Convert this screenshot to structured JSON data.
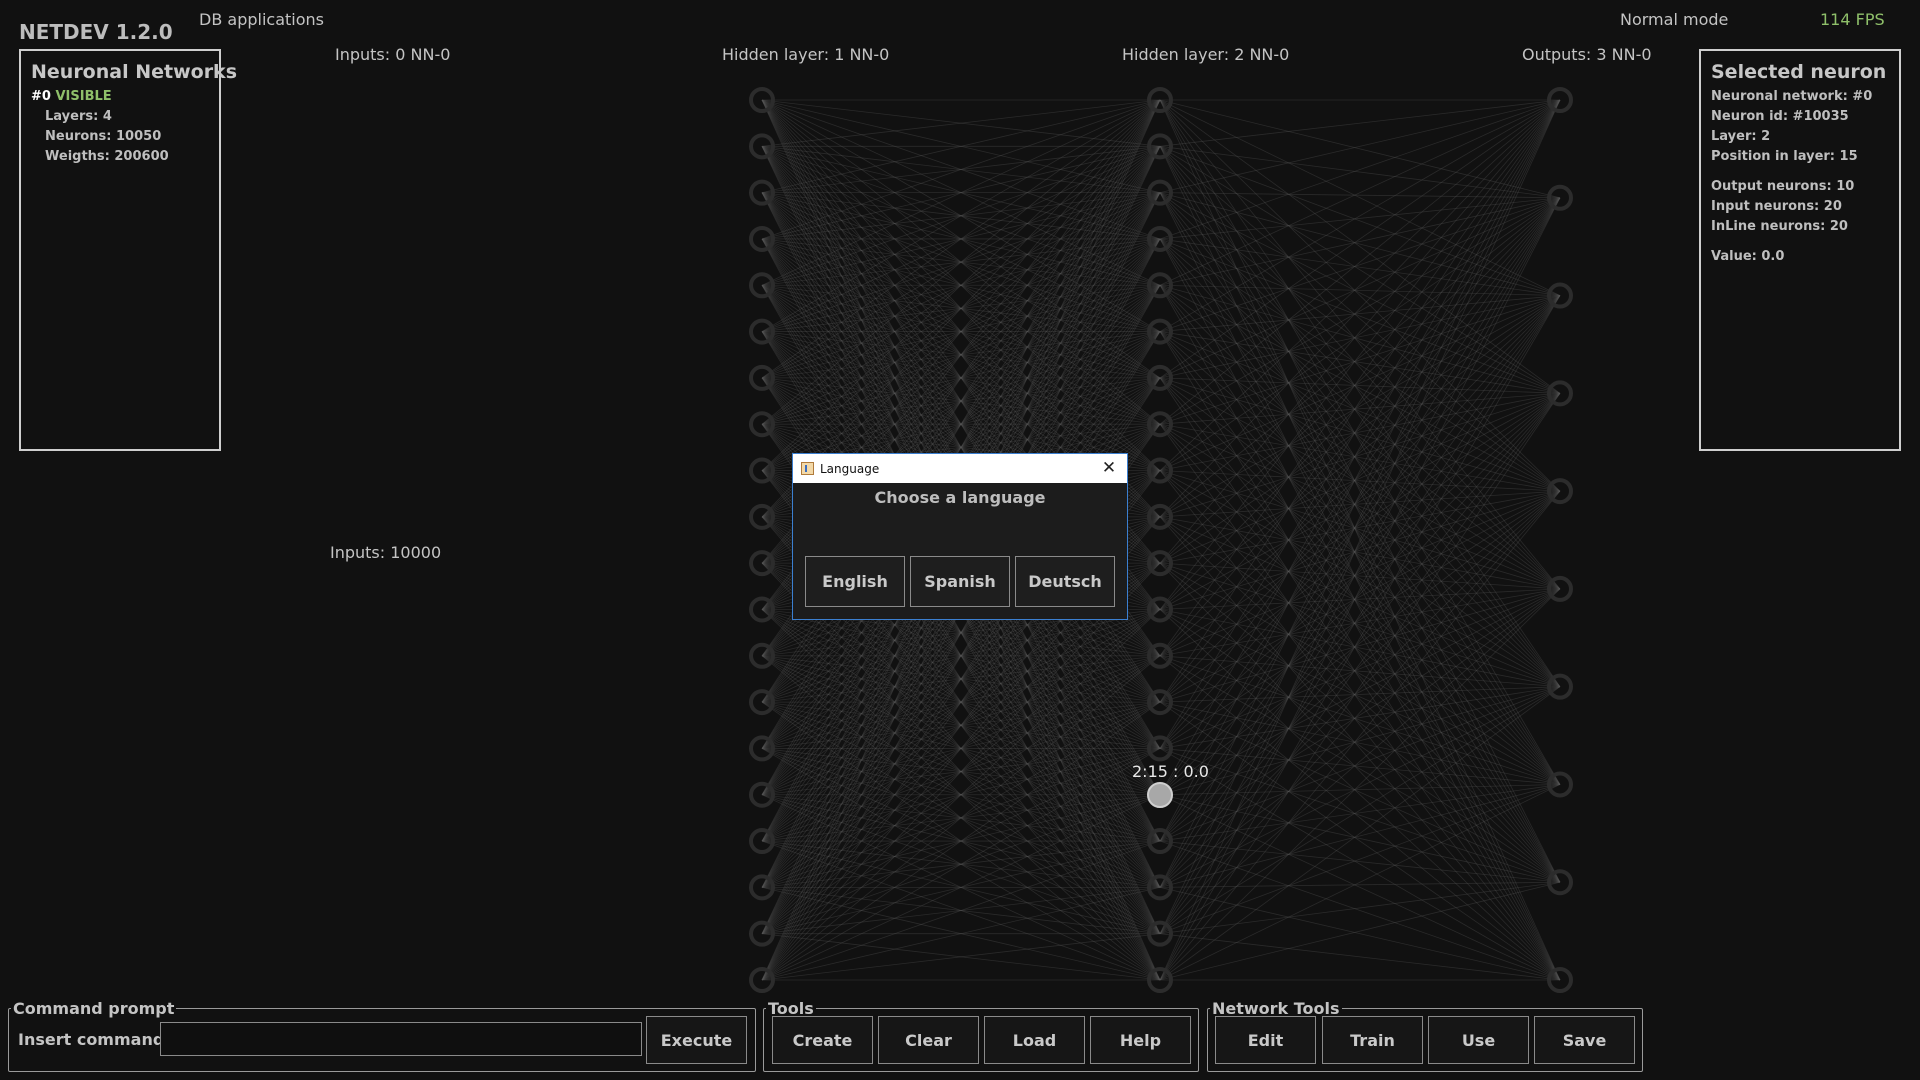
{
  "header": {
    "app_title": "NETDEV 1.2.0",
    "menu_db": "DB applications",
    "mode": "Normal mode",
    "fps": "114 FPS"
  },
  "networks_panel": {
    "title": "Neuronal Networks",
    "id": "#0",
    "status": "VISIBLE",
    "layers": "Layers: 4",
    "neurons": "Neurons: 10050",
    "weights": "Weigths: 200600"
  },
  "selected_panel": {
    "title": "Selected neuron",
    "network": "Neuronal network: #0",
    "neuron_id": "Neuron id: #10035",
    "layer": "Layer: 2",
    "position": "Position in layer: 15",
    "output_neurons": "Output neurons: 10",
    "input_neurons": "Input neurons: 20",
    "inline_neurons": "InLine neurons: 20",
    "value": "Value: 0.0"
  },
  "layers": {
    "inputs": "Inputs: 0  NN-0",
    "hidden1": "Hidden layer: 1  NN-0",
    "hidden2": "Hidden layer: 2  NN-0",
    "outputs": "Outputs: 3  NN-0",
    "inputs_count": "Inputs: 10000"
  },
  "neuron_label": "2:15 : 0.0",
  "command_prompt": {
    "legend": "Command prompt",
    "label": "Insert command:",
    "value": "",
    "execute": "Execute"
  },
  "tools": {
    "legend": "Tools",
    "create": "Create",
    "clear": "Clear",
    "load": "Load",
    "help": "Help"
  },
  "network_tools": {
    "legend": "Network Tools",
    "edit": "Edit",
    "train": "Train",
    "use": "Use",
    "save": "Save"
  },
  "dialog": {
    "title": "Language",
    "prompt": "Choose a language",
    "english": "English",
    "spanish": "Spanish",
    "deutsch": "Deutsch",
    "close_icon": "close-icon"
  },
  "colors": {
    "background": "#111111",
    "accent_green": "#8fc06a",
    "dialog_border": "#3b7fd0"
  }
}
